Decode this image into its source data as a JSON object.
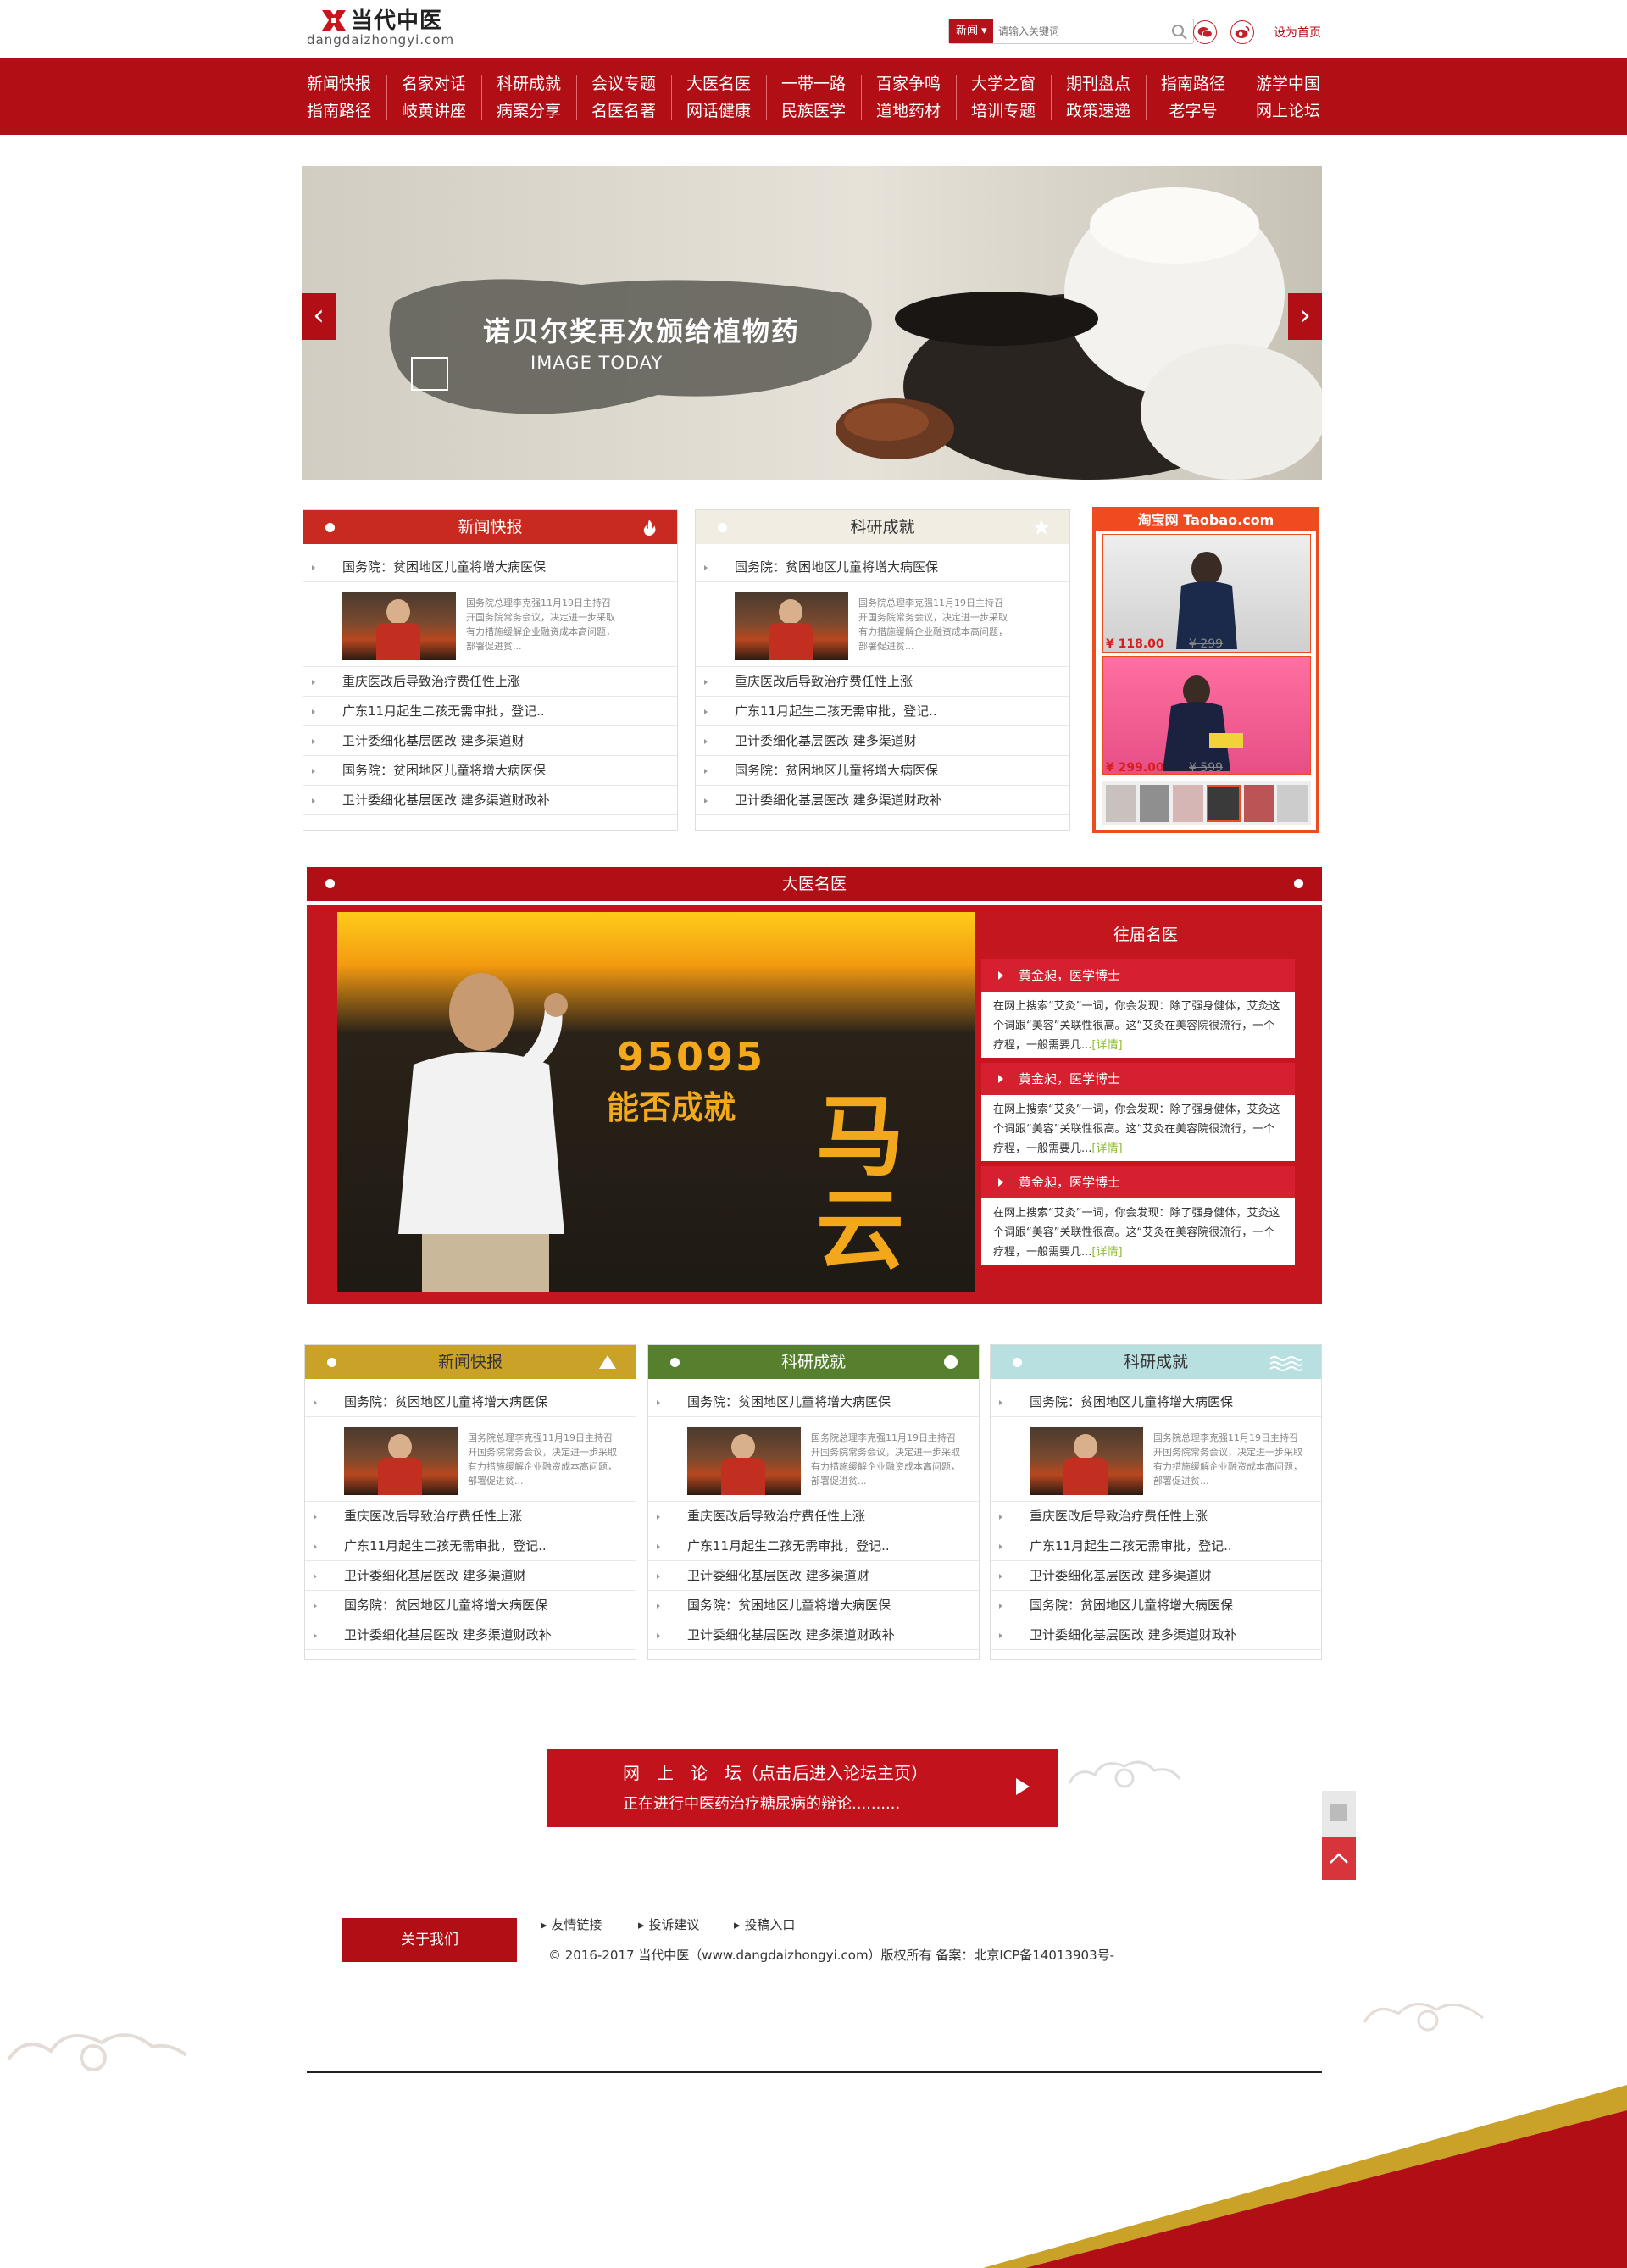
{
  "header": {
    "logo_text": "当代中医",
    "logo_domain": "dangdaizhongyi.com",
    "search_category": "新闻",
    "search_placeholder": "请输入关键词",
    "home_link": "设为首页"
  },
  "nav": [
    [
      "新闻快报",
      "指南路径"
    ],
    [
      "名家对话",
      "岐黄讲座"
    ],
    [
      "科研成就",
      "病案分享"
    ],
    [
      "会议专题",
      "名医名著"
    ],
    [
      "大医名医",
      "网话健康"
    ],
    [
      "一带一路",
      "民族医学"
    ],
    [
      "百家争鸣",
      "道地药材"
    ],
    [
      "大学之窗",
      "培训专题"
    ],
    [
      "期刊盘点",
      "政策速递"
    ],
    [
      "指南路径",
      "老字号"
    ],
    [
      "游学中国",
      "网上论坛"
    ]
  ],
  "banner": {
    "title": "诺贝尔奖再次颁给植物药",
    "subtitle": "IMAGE TODAY",
    "prev": "‹",
    "next": "›"
  },
  "news_top_items": [
    "国务院：贫困地区儿童将增大病医保",
    "重庆医改后导致治疗费任性上涨",
    "广东11月起生二孩无需审批，登记..",
    "卫计委细化基层医改 建多渠道财",
    "国务院：贫困地区儿童将增大病医保",
    "卫计委细化基层医改 建多渠道财政补"
  ],
  "news_desc": "国务院总理李克强11月19日主持召开国务院常务会议，决定进一步采取有力措施缓解企业融资成本高问题，部署促进贫...",
  "boxes_row1": [
    {
      "title": "新闻快报",
      "color": "#c92a1f",
      "text": "#ffffff"
    },
    {
      "title": "科研成就",
      "color": "#f1ede3",
      "text": "#333333"
    }
  ],
  "taobao": {
    "title": "淘宝网 Taobao.com",
    "item1_price": "¥ 118.00",
    "item1_old": "¥ 299",
    "item2_price": "¥ 299.00",
    "item2_old": "¥ 599"
  },
  "doctors": {
    "section_title": "大医名医",
    "panel_title": "往届名医",
    "poster_num": "95095",
    "poster_tag": "能否成就",
    "poster_name": "马云",
    "items": [
      {
        "title": "黄金昶，医学博士",
        "desc": "在网上搜索“艾灸”一词，你会发现：除了强身健体，艾灸这个词跟“美容”关联性很高。这“艾灸在美容院很流行，一个疗程，一般需要几...",
        "more": "[详情]"
      },
      {
        "title": "黄金昶，医学博士",
        "desc": "在网上搜索“艾灸”一词，你会发现：除了强身健体，艾灸这个词跟“美容”关联性很高。这“艾灸在美容院很流行，一个疗程，一般需要几...",
        "more": "[详情]"
      },
      {
        "title": "黄金昶，医学博士",
        "desc": "在网上搜索“艾灸”一词，你会发现：除了强身健体，艾灸这个词跟“美容”关联性很高。这“艾灸在美容院很流行，一个疗程，一般需要几...",
        "more": "[详情]"
      }
    ]
  },
  "boxes_row2": [
    {
      "title": "新闻快报",
      "color": "#c9a227",
      "text": "#333333"
    },
    {
      "title": "科研成就",
      "color": "#56802d",
      "text": "#ffffff"
    },
    {
      "title": "科研成就",
      "color": "#b9e0e0",
      "text": "#333333"
    }
  ],
  "forum": {
    "title": "网　上　论　坛（点击后进入论坛主页）",
    "subtitle": "正在进行中医药治疗糖尿病的辩论.........."
  },
  "footer": {
    "about": "关于我们",
    "links": [
      "友情链接",
      "投诉建议",
      "投稿入口"
    ],
    "copyright": "© 2016-2017 当代中医（www.dangdaizhongyi.com）版权所有 备案：北京ICP备14013903号-"
  }
}
